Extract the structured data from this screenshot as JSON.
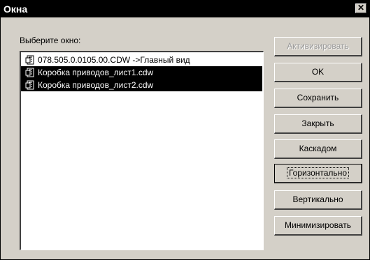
{
  "window": {
    "title": "Окна",
    "close_glyph": "✕"
  },
  "prompt": "Выберите окно:",
  "list": [
    {
      "label": "078.505.0.0105.00.CDW ->Главный вид",
      "selected": false,
      "icon": "document-icon"
    },
    {
      "label": "Коробка приводов_лист1.cdw",
      "selected": true,
      "icon": "document-icon"
    },
    {
      "label": "Коробка приводов_лист2.cdw",
      "selected": true,
      "icon": "document-icon"
    }
  ],
  "buttons": {
    "activate": "Активизировать",
    "ok": "OK",
    "save": "Сохранить",
    "close": "Закрыть",
    "cascade": "Каскадом",
    "horizontal": "Горизонтально",
    "vertical": "Вертикально",
    "minimize": "Минимизировать"
  },
  "colors": {
    "window_bg": "#d4d0c8",
    "selection": "#000000",
    "titlebar": "#000000"
  }
}
